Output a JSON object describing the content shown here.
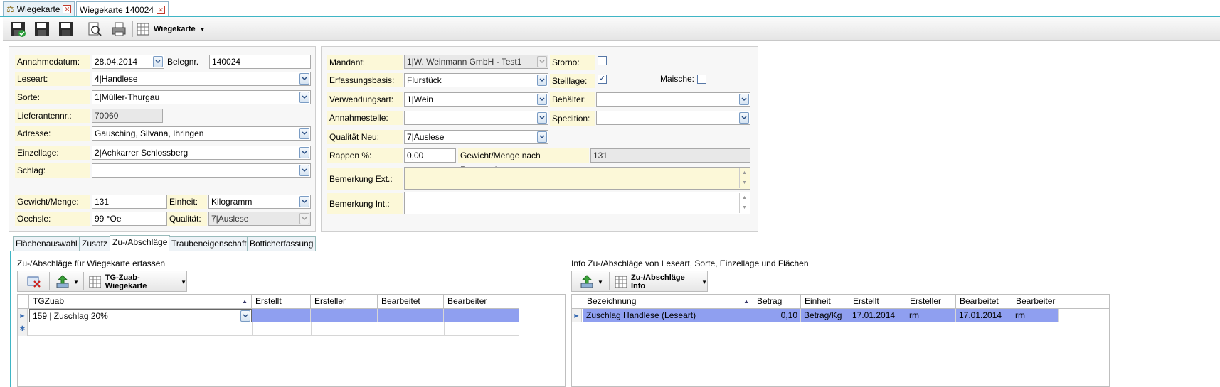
{
  "tabs": [
    {
      "label": "Wiegekarte",
      "active": false
    },
    {
      "label": "Wiegekarte 140024",
      "active": true
    }
  ],
  "toolbar": {
    "dropdown_label": "Wiegekarte"
  },
  "left_form": {
    "annahmedatum_label": "Annahmedatum:",
    "annahmedatum_value": "28.04.2014",
    "belegnr_label": "Belegnr.",
    "belegnr_value": "140024",
    "leseart_label": "Leseart:",
    "leseart_value": "4|Handlese",
    "sorte_label": "Sorte:",
    "sorte_value": "1|Müller-Thurgau",
    "lieferantennr_label": "Lieferantennr.:",
    "lieferantennr_value": "70060",
    "adresse_label": "Adresse:",
    "adresse_value": "Gausching, Silvana, Ihringen",
    "einzellage_label": "Einzellage:",
    "einzellage_value": "2|Achkarrer Schlossberg",
    "schlag_label": "Schlag:",
    "schlag_value": "",
    "gewicht_label": "Gewicht/Menge:",
    "gewicht_value": "131",
    "einheit_label": "Einheit:",
    "einheit_value": "Kilogramm",
    "oechsle_label": "Oechsle:",
    "oechsle_value": "99 °Oe",
    "qualitaet_label": "Qualität:",
    "qualitaet_value": "7|Auslese"
  },
  "right_form": {
    "mandant_label": "Mandant:",
    "mandant_value": "1|W. Weinmann GmbH - Test1",
    "storno_label": "Storno:",
    "storno_checked": false,
    "erfassungsbasis_label": "Erfassungsbasis:",
    "erfassungsbasis_value": "Flurstück",
    "steillage_label": "Steillage:",
    "steillage_checked": true,
    "maische_label": "Maische:",
    "maische_checked": false,
    "verwendungsart_label": "Verwendungsart:",
    "verwendungsart_value": "1|Wein",
    "behaelter_label": "Behälter:",
    "behaelter_value": "",
    "annahmestelle_label": "Annahmestelle:",
    "annahmestelle_value": "",
    "spedition_label": "Spedition:",
    "spedition_value": "",
    "qualitaet_neu_label": "Qualität Neu:",
    "qualitaet_neu_value": "7|Auslese",
    "rappen_label": "Rappen %:",
    "rappen_value": "0,00",
    "gewicht_nach_label": "Gewicht/Menge nach Rappenabzug:",
    "gewicht_nach_value": "131",
    "bemerkung_ext_label": "Bemerkung Ext.:",
    "bemerkung_ext_value": "",
    "bemerkung_int_label": "Bemerkung Int.:",
    "bemerkung_int_value": ""
  },
  "bottom_tabs": [
    {
      "label": "Flächenauswahl",
      "active": false
    },
    {
      "label": "Zusatz",
      "active": false
    },
    {
      "label": "Zu-/Abschläge",
      "active": true
    },
    {
      "label": "Traubeneigenschaft",
      "active": false
    },
    {
      "label": "Botticherfassung",
      "active": false
    }
  ],
  "left_grid": {
    "title": "Zu-/Abschläge für Wiegekarte erfassen",
    "toolbar_dropdown": "TG-Zuab-Wiegekarte",
    "columns": [
      "TGZuab",
      "Erstellt",
      "Ersteller",
      "Bearbeitet",
      "Bearbeiter"
    ],
    "rows": [
      [
        "159 | Zuschlag 20%",
        "",
        "",
        "",
        ""
      ]
    ]
  },
  "right_grid": {
    "title": "Info Zu-/Abschläge von Leseart, Sorte, Einzellage und Flächen",
    "toolbar_dropdown": "Zu-/Abschläge Info",
    "columns": [
      "Bezeichnung",
      "Betrag",
      "Einheit",
      "Erstellt",
      "Ersteller",
      "Bearbeitet",
      "Bearbeiter"
    ],
    "rows": [
      [
        "Zuschlag Handlese (Leseart)",
        "0,10",
        "Betrag/Kg",
        "17.01.2014",
        "rm",
        "17.01.2014",
        "rm"
      ]
    ]
  }
}
